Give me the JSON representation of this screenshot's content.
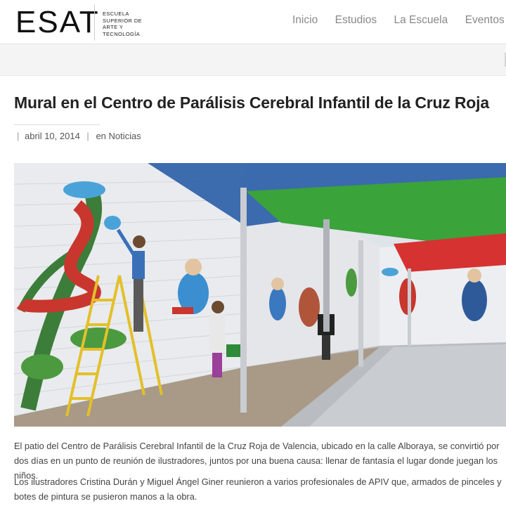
{
  "logo": {
    "mark": "ESAT",
    "sub_lines": [
      "ESCUELA",
      "SUPERIOR DE",
      "ARTE Y",
      "TECNOLOGÍA"
    ]
  },
  "nav": {
    "items": [
      "Inicio",
      "Estudios",
      "La Escuela",
      "Eventos"
    ]
  },
  "article": {
    "title": "Mural en el Centro de Parálisis Cerebral Infantil de la Cruz Roja",
    "date": "abril 10, 2014",
    "category_prefix": "en",
    "category": "Noticias",
    "paragraphs": [
      "El patio del Centro de Parálisis Cerebral Infantil de la Cruz Roja de Valencia, ubicado en la calle Alboraya, se convirtió por dos días en un punto de reunión de ilustradores, juntos por una buena causa: llenar de fantasía el lugar donde juegan los niños.",
      "Los ilustradores Cristina Durán y Miguel Ángel Giner reunieron a varios profesionales de APIV que, armados de pinceles y botes de pintura se pusieron manos a la obra."
    ]
  },
  "colors": {
    "title": "#222222",
    "nav_text": "#888888",
    "awning_blue": "#2d5fa8",
    "awning_green": "#3aa33a",
    "awning_red": "#d63232"
  }
}
